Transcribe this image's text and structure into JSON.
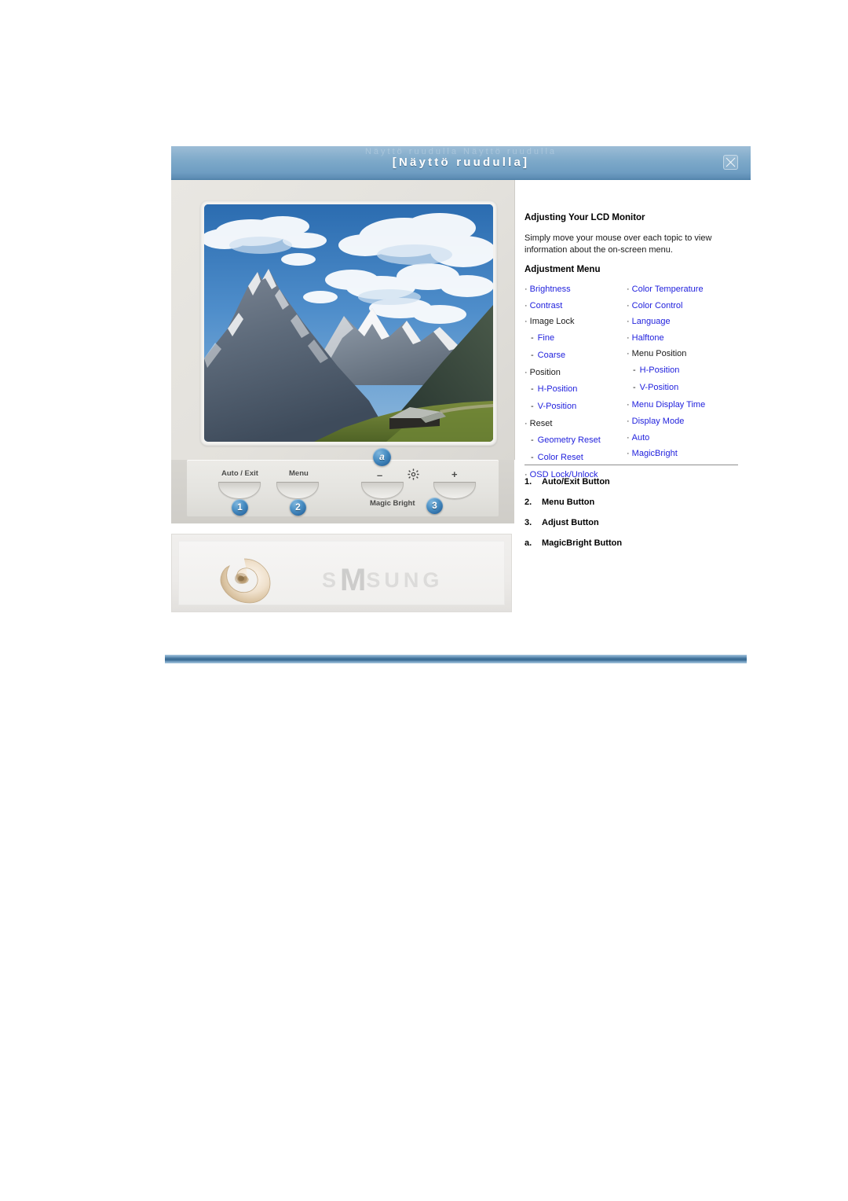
{
  "window": {
    "title": "[Näyttö  ruudulla]",
    "title_watermark": "Näyttö   ruudulla   Näyttö   ruudulla",
    "close_icon": "close-icon"
  },
  "monitor": {
    "screen_image_alt": "mountain-landscape-photo",
    "controls": [
      {
        "label": "Auto / Exit",
        "badge": "1"
      },
      {
        "label": "Menu",
        "badge": "2"
      },
      {
        "label": "–",
        "badge": ""
      },
      {
        "label": "+",
        "badge": ""
      }
    ],
    "gear_icon": "brightness-gear-icon",
    "magic_bright_label": "Magic Bright",
    "magic_bright_badge": "3",
    "minus_label": "–",
    "plus_label": "+",
    "badge_a": "a",
    "brand_watermark_prefix": "S",
    "brand_watermark_m": "M",
    "brand_watermark_suffix": "SUNG",
    "shell_logo": "nautilus-shell-logo"
  },
  "info": {
    "heading": "Adjusting Your LCD Monitor",
    "intro": "Simply move your mouse over each topic to view information about the on-screen menu.",
    "adjustment_heading": "Adjustment Menu",
    "menu_left": [
      {
        "label": "Brightness",
        "marker": "bullet",
        "level": 1,
        "link": true
      },
      {
        "label": "Contrast",
        "marker": "bullet",
        "level": 1,
        "link": true
      },
      {
        "label": "Image Lock",
        "marker": "bullet",
        "level": 1,
        "link": false
      },
      {
        "label": "Fine",
        "marker": "dash",
        "level": 2,
        "link": true
      },
      {
        "label": "Coarse",
        "marker": "dash",
        "level": 2,
        "link": true
      },
      {
        "label": "Position",
        "marker": "bullet",
        "level": 1,
        "link": false
      },
      {
        "label": "H-Position",
        "marker": "dash",
        "level": 2,
        "link": true
      },
      {
        "label": "V-Position",
        "marker": "dash",
        "level": 2,
        "link": true
      },
      {
        "label": "Reset",
        "marker": "bullet",
        "level": 1,
        "link": false
      },
      {
        "label": "Geometry Reset",
        "marker": "dash",
        "level": 2,
        "link": true
      },
      {
        "label": "Color Reset",
        "marker": "dash",
        "level": 2,
        "link": true
      },
      {
        "label": "OSD Lock/Unlock",
        "marker": "bullet",
        "level": 1,
        "link": true
      }
    ],
    "menu_right": [
      {
        "label": "Color Temperature",
        "marker": "bullet",
        "level": 1,
        "link": true
      },
      {
        "label": "Color Control",
        "marker": "bullet",
        "level": 1,
        "link": true
      },
      {
        "label": "Language",
        "marker": "bullet",
        "level": 1,
        "link": true
      },
      {
        "label": "Halftone",
        "marker": "bullet",
        "level": 1,
        "link": true
      },
      {
        "label": "Menu Position",
        "marker": "bullet",
        "level": 1,
        "link": false
      },
      {
        "label": "H-Position",
        "marker": "dash",
        "level": 2,
        "link": true
      },
      {
        "label": "V-Position",
        "marker": "dash",
        "level": 2,
        "link": true
      },
      {
        "label": "Menu Display Time",
        "marker": "bullet",
        "level": 1,
        "link": true
      },
      {
        "label": "Display Mode",
        "marker": "bullet",
        "level": 1,
        "link": true
      },
      {
        "label": "Auto",
        "marker": "bullet",
        "level": 1,
        "link": true
      },
      {
        "label": "MagicBright",
        "marker": "bullet",
        "level": 1,
        "link": true
      }
    ],
    "legend": [
      {
        "num": "1.",
        "label": "Auto/Exit Button"
      },
      {
        "num": "2.",
        "label": "Menu Button"
      },
      {
        "num": "3.",
        "label": "Adjust Button"
      },
      {
        "num": "a.",
        "label": "MagicBright Button"
      }
    ]
  },
  "colors": {
    "title_bar": "#7faaca",
    "link_blue": "#2222dd",
    "badge_blue": "#2f6ea6",
    "divider_blue": "#3c6e96",
    "bezel_gray": "#e3e1dc"
  }
}
